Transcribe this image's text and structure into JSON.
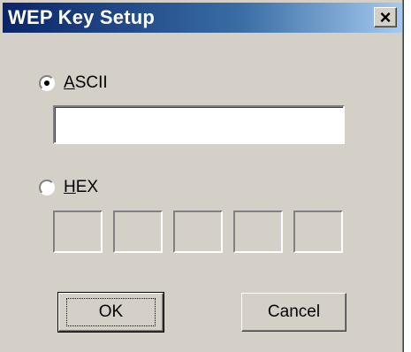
{
  "window": {
    "title": "WEP Key Setup",
    "close_label": "×"
  },
  "ascii": {
    "label_underlined": "A",
    "label_rest": "SCII",
    "checked": true,
    "value": ""
  },
  "hex": {
    "label_underlined": "H",
    "label_rest": "EX",
    "checked": false,
    "fields": [
      "",
      "",
      "",
      "",
      ""
    ]
  },
  "buttons": {
    "ok_label": "OK",
    "cancel_label": "Cancel"
  }
}
